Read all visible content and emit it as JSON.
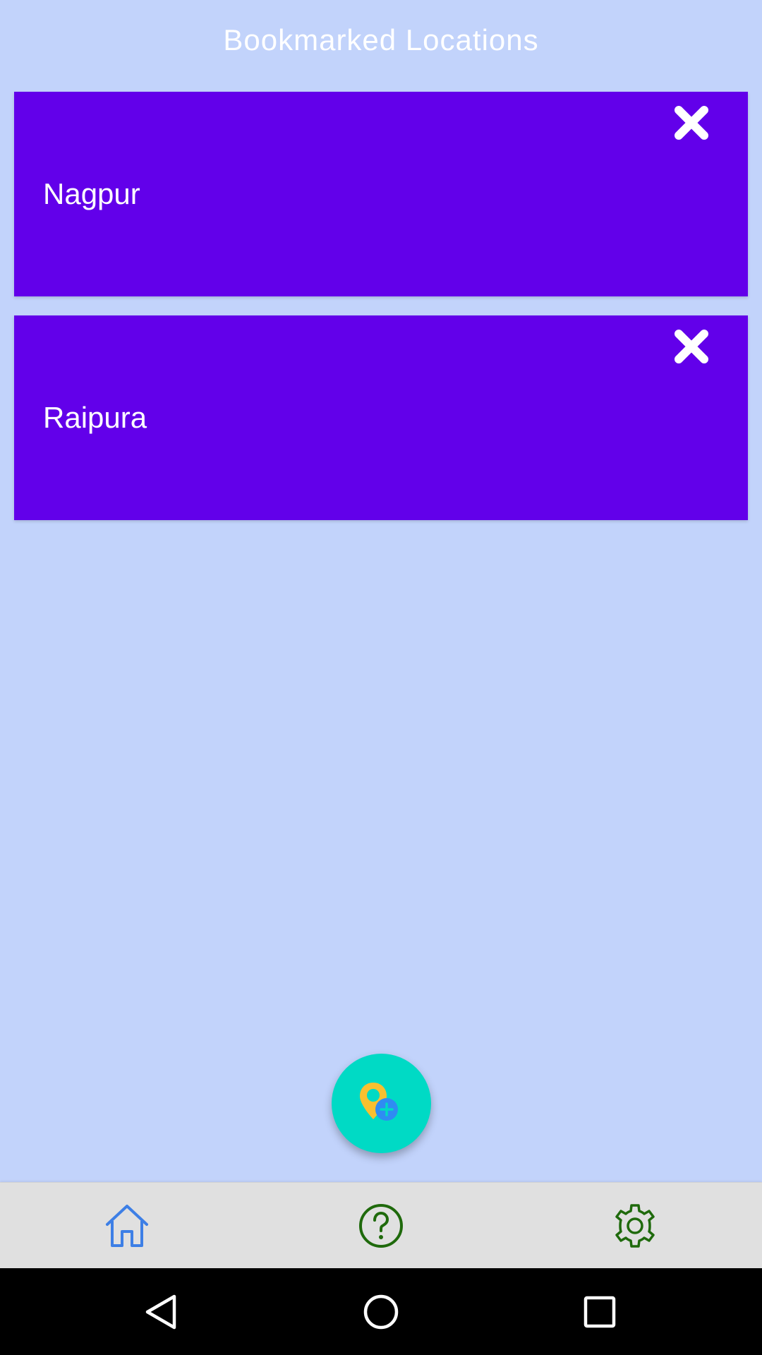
{
  "screen": {
    "title": "Bookmarked Locations"
  },
  "colors": {
    "background": "#c2d3fb",
    "card": "#6200ea",
    "fab": "#00dac5",
    "pin": "#f9c02f",
    "pin_badge": "#2f8cf2",
    "bottom_nav": "#e0e0e0",
    "home_icon": "#3d7fe6",
    "nav_green": "#1f6a0c",
    "system_bar": "#000000"
  },
  "bookmarks": [
    {
      "name": "Nagpur",
      "close_icon": "close-icon"
    },
    {
      "name": "Raipura",
      "close_icon": "close-icon"
    }
  ],
  "fab": {
    "icon": "add-location-icon"
  },
  "bottom_nav": {
    "items": [
      {
        "icon": "home-icon"
      },
      {
        "icon": "help-icon"
      },
      {
        "icon": "gear-icon"
      }
    ]
  },
  "system_nav": {
    "items": [
      {
        "icon": "back-icon"
      },
      {
        "icon": "home-circle-icon"
      },
      {
        "icon": "recents-icon"
      }
    ]
  }
}
